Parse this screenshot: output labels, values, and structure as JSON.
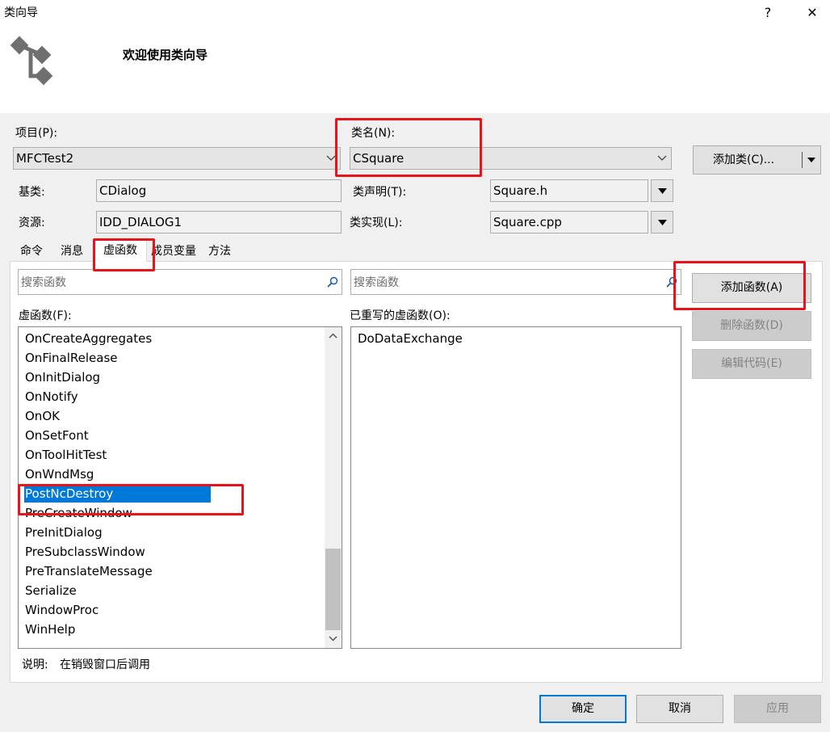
{
  "window": {
    "title": "类向导",
    "help_label": "?",
    "close_label": "✕"
  },
  "header": {
    "welcome": "欢迎使用类向导",
    "logo_icon": "class-wizard-icon"
  },
  "project": {
    "label": "项目(P):",
    "value": "MFCTest2"
  },
  "class_name": {
    "label": "类名(N):",
    "value": "CSquare"
  },
  "add_class_button": "添加类(C)...",
  "base_class": {
    "label": "基类:",
    "value": "CDialog"
  },
  "class_decl": {
    "label": "类声明(T):",
    "value": "Square.h"
  },
  "resource": {
    "label": "资源:",
    "value": "IDD_DIALOG1"
  },
  "class_impl": {
    "label": "类实现(L):",
    "value": "Square.cpp"
  },
  "tabs": [
    {
      "label": "命令",
      "active": false
    },
    {
      "label": "消息",
      "active": false
    },
    {
      "label": "虚函数",
      "active": true
    },
    {
      "label": "成员变量",
      "active": false
    },
    {
      "label": "方法",
      "active": false
    }
  ],
  "search": {
    "left_placeholder": "搜索函数",
    "right_placeholder": "搜索函数"
  },
  "virtual_functions": {
    "label": "虚函数(F):",
    "items": [
      "OnCreateAggregates",
      "OnFinalRelease",
      "OnInitDialog",
      "OnNotify",
      "OnOK",
      "OnSetFont",
      "OnToolHitTest",
      "OnWndMsg",
      "PostNcDestroy",
      "PreCreateWindow",
      "PreInitDialog",
      "PreSubclassWindow",
      "PreTranslateMessage",
      "Serialize",
      "WindowProc",
      "WinHelp"
    ],
    "selected": "PostNcDestroy"
  },
  "overridden": {
    "label": "已重写的虚函数(O):",
    "items": [
      "DoDataExchange"
    ]
  },
  "side_buttons": {
    "add_function": "添加函数(A)",
    "delete_function": "删除函数(D)",
    "edit_code": "编辑代码(E)"
  },
  "description": {
    "label": "说明:",
    "text": "在销毁窗口后调用"
  },
  "footer": {
    "ok": "确定",
    "cancel": "取消",
    "apply": "应用"
  },
  "colors": {
    "highlight_annotation": "#e8141b",
    "selection": "#0078d7"
  }
}
